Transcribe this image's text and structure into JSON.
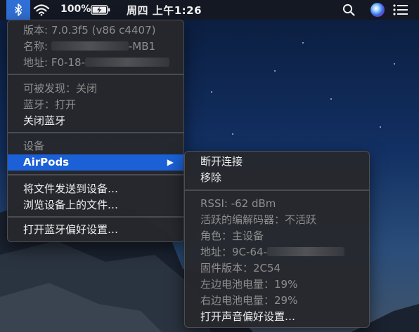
{
  "menubar": {
    "battery_percent": "100%",
    "clock": "周四 上午1:26",
    "icons": [
      "bluetooth-icon",
      "wifi-icon",
      "battery-charging-icon",
      "search-icon",
      "siri-icon",
      "notification-list-icon"
    ]
  },
  "bt_menu": {
    "version_label": "版本",
    "version_value": "7.0.3f5 (v86 c4407)",
    "name_label": "名称",
    "name_suffix": "-MB1",
    "address_label": "地址",
    "address_prefix": "F0-18-",
    "discoverable": "可被发现：关闭",
    "bluetooth_state": "蓝牙：打开",
    "turn_off": "关闭蓝牙",
    "devices_header": "设备",
    "airpods": "AirPods",
    "send_file": "将文件发送到设备…",
    "browse_files": "浏览设备上的文件…",
    "open_prefs": "打开蓝牙偏好设置…"
  },
  "airpods_menu": {
    "disconnect": "断开连接",
    "remove": "移除",
    "rssi": "RSSI:  -62 dBm",
    "codec": "活跃的编解码器：不活跃",
    "role": "角色：主设备",
    "address_label": "地址：",
    "address_prefix": "9C-64-",
    "firmware": "固件版本：2C54",
    "left_battery_label": "左边电池电量：",
    "left_battery_value": "19%",
    "right_battery_label": "右边电池电量：",
    "right_battery_value": "29%",
    "sound_prefs": "打开声音偏好设置…"
  },
  "colors": {
    "highlight": "#1b60d6",
    "menu_bg": "#26282c",
    "disabled_text": "#8e8e8e"
  }
}
